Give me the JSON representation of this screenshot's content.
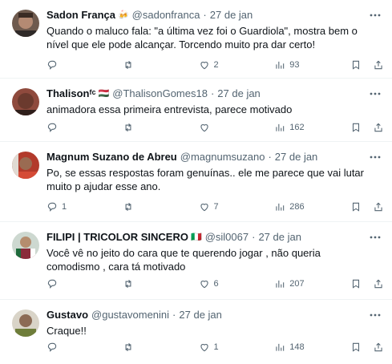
{
  "tweets": [
    {
      "name": "Sadon França",
      "name_emoji": "🍻",
      "handle": "@sadonfranca",
      "dot": "·",
      "time": "27 de jan",
      "text": "Quando o maluco fala: \"a última vez foi o Guardiola\", mostra bem o nível que ele pode alcançar. Torcendo muito pra dar certo!",
      "replies": "",
      "retweets": "",
      "likes": "2",
      "views": "93"
    },
    {
      "name": "Thalisonᶠᶜ",
      "name_emoji": "🇭🇺",
      "handle": "@ThalisonGomes18",
      "dot": "·",
      "time": "27 de jan",
      "text": "animadora essa primeira entrevista, parece motivado",
      "replies": "",
      "retweets": "",
      "likes": "",
      "views": "162"
    },
    {
      "name": "Magnum Suzano de Abreu",
      "name_emoji": "",
      "handle": "@magnumsuzano",
      "dot": "·",
      "time": "27 de jan",
      "text": "Po, se essas respostas foram genuínas.. ele me parece que vai lutar muito p ajudar esse ano.",
      "replies": "1",
      "retweets": "",
      "likes": "7",
      "views": "286"
    },
    {
      "name": "FILIPI | TRICOLOR SINCERO",
      "name_emoji": "🇮🇹",
      "handle": "@sil0067",
      "dot": "·",
      "time": "27 de jan",
      "text": "Você vê no jeito do cara que te querendo jogar , não queria comodismo , cara tá motivado",
      "replies": "",
      "retweets": "",
      "likes": "6",
      "views": "207"
    },
    {
      "name": "Gustavo",
      "name_emoji": "",
      "handle": "@gustavomenini",
      "dot": "·",
      "time": "27 de jan",
      "text": "Craque!!",
      "replies": "",
      "retweets": "",
      "likes": "1",
      "views": "148"
    }
  ],
  "icons": {
    "more": "more-horizontal-icon",
    "reply": "reply-icon",
    "retweet": "retweet-icon",
    "like": "heart-icon",
    "views": "views-chart-icon",
    "bookmark": "bookmark-icon",
    "share": "share-icon"
  },
  "colors": {
    "text": "#0f1419",
    "muted": "#536471",
    "divider": "#eff3f4"
  }
}
